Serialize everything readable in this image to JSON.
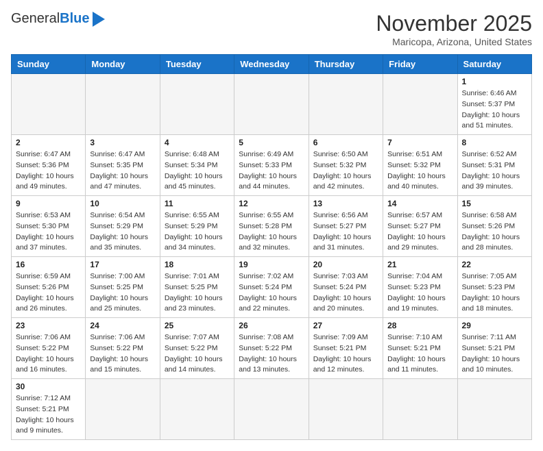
{
  "header": {
    "logo_general": "General",
    "logo_blue": "Blue",
    "month": "November 2025",
    "location": "Maricopa, Arizona, United States"
  },
  "days_of_week": [
    "Sunday",
    "Monday",
    "Tuesday",
    "Wednesday",
    "Thursday",
    "Friday",
    "Saturday"
  ],
  "weeks": [
    [
      {
        "day": "",
        "info": "",
        "empty": true
      },
      {
        "day": "",
        "info": "",
        "empty": true
      },
      {
        "day": "",
        "info": "",
        "empty": true
      },
      {
        "day": "",
        "info": "",
        "empty": true
      },
      {
        "day": "",
        "info": "",
        "empty": true
      },
      {
        "day": "",
        "info": "",
        "empty": true
      },
      {
        "day": "1",
        "info": "Sunrise: 6:46 AM\nSunset: 5:37 PM\nDaylight: 10 hours and 51 minutes.",
        "empty": false
      }
    ],
    [
      {
        "day": "2",
        "info": "Sunrise: 6:47 AM\nSunset: 5:36 PM\nDaylight: 10 hours and 49 minutes.",
        "empty": false
      },
      {
        "day": "3",
        "info": "Sunrise: 6:47 AM\nSunset: 5:35 PM\nDaylight: 10 hours and 47 minutes.",
        "empty": false
      },
      {
        "day": "4",
        "info": "Sunrise: 6:48 AM\nSunset: 5:34 PM\nDaylight: 10 hours and 45 minutes.",
        "empty": false
      },
      {
        "day": "5",
        "info": "Sunrise: 6:49 AM\nSunset: 5:33 PM\nDaylight: 10 hours and 44 minutes.",
        "empty": false
      },
      {
        "day": "6",
        "info": "Sunrise: 6:50 AM\nSunset: 5:32 PM\nDaylight: 10 hours and 42 minutes.",
        "empty": false
      },
      {
        "day": "7",
        "info": "Sunrise: 6:51 AM\nSunset: 5:32 PM\nDaylight: 10 hours and 40 minutes.",
        "empty": false
      },
      {
        "day": "8",
        "info": "Sunrise: 6:52 AM\nSunset: 5:31 PM\nDaylight: 10 hours and 39 minutes.",
        "empty": false
      }
    ],
    [
      {
        "day": "9",
        "info": "Sunrise: 6:53 AM\nSunset: 5:30 PM\nDaylight: 10 hours and 37 minutes.",
        "empty": false
      },
      {
        "day": "10",
        "info": "Sunrise: 6:54 AM\nSunset: 5:29 PM\nDaylight: 10 hours and 35 minutes.",
        "empty": false
      },
      {
        "day": "11",
        "info": "Sunrise: 6:55 AM\nSunset: 5:29 PM\nDaylight: 10 hours and 34 minutes.",
        "empty": false
      },
      {
        "day": "12",
        "info": "Sunrise: 6:55 AM\nSunset: 5:28 PM\nDaylight: 10 hours and 32 minutes.",
        "empty": false
      },
      {
        "day": "13",
        "info": "Sunrise: 6:56 AM\nSunset: 5:27 PM\nDaylight: 10 hours and 31 minutes.",
        "empty": false
      },
      {
        "day": "14",
        "info": "Sunrise: 6:57 AM\nSunset: 5:27 PM\nDaylight: 10 hours and 29 minutes.",
        "empty": false
      },
      {
        "day": "15",
        "info": "Sunrise: 6:58 AM\nSunset: 5:26 PM\nDaylight: 10 hours and 28 minutes.",
        "empty": false
      }
    ],
    [
      {
        "day": "16",
        "info": "Sunrise: 6:59 AM\nSunset: 5:26 PM\nDaylight: 10 hours and 26 minutes.",
        "empty": false
      },
      {
        "day": "17",
        "info": "Sunrise: 7:00 AM\nSunset: 5:25 PM\nDaylight: 10 hours and 25 minutes.",
        "empty": false
      },
      {
        "day": "18",
        "info": "Sunrise: 7:01 AM\nSunset: 5:25 PM\nDaylight: 10 hours and 23 minutes.",
        "empty": false
      },
      {
        "day": "19",
        "info": "Sunrise: 7:02 AM\nSunset: 5:24 PM\nDaylight: 10 hours and 22 minutes.",
        "empty": false
      },
      {
        "day": "20",
        "info": "Sunrise: 7:03 AM\nSunset: 5:24 PM\nDaylight: 10 hours and 20 minutes.",
        "empty": false
      },
      {
        "day": "21",
        "info": "Sunrise: 7:04 AM\nSunset: 5:23 PM\nDaylight: 10 hours and 19 minutes.",
        "empty": false
      },
      {
        "day": "22",
        "info": "Sunrise: 7:05 AM\nSunset: 5:23 PM\nDaylight: 10 hours and 18 minutes.",
        "empty": false
      }
    ],
    [
      {
        "day": "23",
        "info": "Sunrise: 7:06 AM\nSunset: 5:22 PM\nDaylight: 10 hours and 16 minutes.",
        "empty": false
      },
      {
        "day": "24",
        "info": "Sunrise: 7:06 AM\nSunset: 5:22 PM\nDaylight: 10 hours and 15 minutes.",
        "empty": false
      },
      {
        "day": "25",
        "info": "Sunrise: 7:07 AM\nSunset: 5:22 PM\nDaylight: 10 hours and 14 minutes.",
        "empty": false
      },
      {
        "day": "26",
        "info": "Sunrise: 7:08 AM\nSunset: 5:22 PM\nDaylight: 10 hours and 13 minutes.",
        "empty": false
      },
      {
        "day": "27",
        "info": "Sunrise: 7:09 AM\nSunset: 5:21 PM\nDaylight: 10 hours and 12 minutes.",
        "empty": false
      },
      {
        "day": "28",
        "info": "Sunrise: 7:10 AM\nSunset: 5:21 PM\nDaylight: 10 hours and 11 minutes.",
        "empty": false
      },
      {
        "day": "29",
        "info": "Sunrise: 7:11 AM\nSunset: 5:21 PM\nDaylight: 10 hours and 10 minutes.",
        "empty": false
      }
    ],
    [
      {
        "day": "30",
        "info": "Sunrise: 7:12 AM\nSunset: 5:21 PM\nDaylight: 10 hours and 9 minutes.",
        "empty": false,
        "last": true
      },
      {
        "day": "",
        "info": "",
        "empty": true,
        "last": true
      },
      {
        "day": "",
        "info": "",
        "empty": true,
        "last": true
      },
      {
        "day": "",
        "info": "",
        "empty": true,
        "last": true
      },
      {
        "day": "",
        "info": "",
        "empty": true,
        "last": true
      },
      {
        "day": "",
        "info": "",
        "empty": true,
        "last": true
      },
      {
        "day": "",
        "info": "",
        "empty": true,
        "last": true
      }
    ]
  ]
}
